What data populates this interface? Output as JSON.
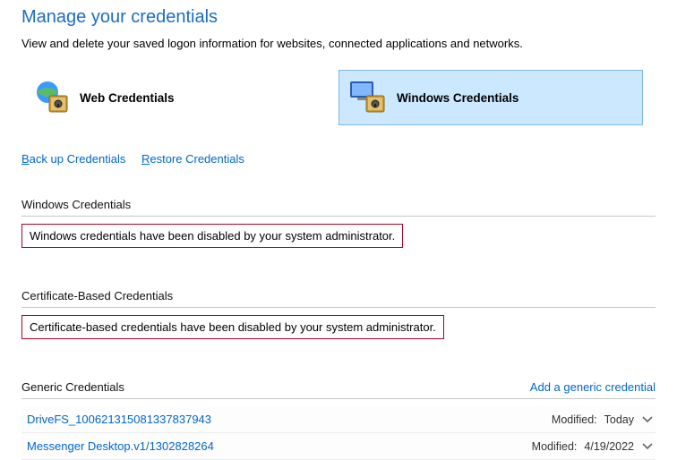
{
  "header": {
    "title": "Manage your credentials",
    "subtitle": "View and delete your saved logon information for websites, connected applications and networks."
  },
  "tabs": {
    "web": {
      "label": "Web Credentials"
    },
    "windows": {
      "label": "Windows Credentials"
    }
  },
  "links": {
    "backup_pre": "B",
    "backup_rest": "ack up Credentials",
    "restore_pre": "R",
    "restore_rest": "estore Credentials"
  },
  "sections": {
    "windows": {
      "header": "Windows Credentials",
      "disabled_msg": "Windows credentials have been disabled by your system administrator."
    },
    "cert": {
      "header": "Certificate-Based Credentials",
      "disabled_msg": "Certificate-based credentials have been disabled by your system administrator."
    },
    "generic": {
      "header": "Generic Credentials",
      "add_label": "Add a generic credential",
      "modified_label": "Modified:",
      "items": [
        {
          "name": "DriveFS_100621315081337837943",
          "modified": "Today"
        },
        {
          "name": "Messenger Desktop.v1/1302828264",
          "modified": "4/19/2022"
        }
      ]
    }
  }
}
